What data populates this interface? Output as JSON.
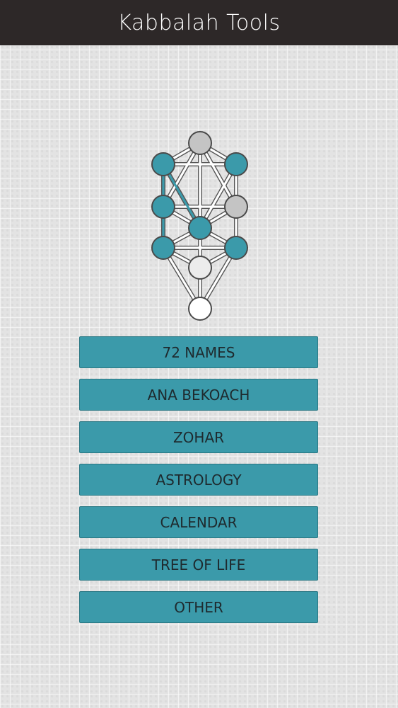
{
  "header": {
    "title": "Kabbalah Tools"
  },
  "colors": {
    "header_bg": "#2d2828",
    "accent": "#3b9aaa",
    "node_gray": "#c4c4c4",
    "node_white": "#ffffff"
  },
  "logo": {
    "icon": "tree-of-life-icon"
  },
  "menu": {
    "items": [
      {
        "label": "72 NAMES"
      },
      {
        "label": "ANA BEKOACH"
      },
      {
        "label": "ZOHAR"
      },
      {
        "label": "ASTROLOGY"
      },
      {
        "label": "CALENDAR"
      },
      {
        "label": "TREE OF LIFE"
      },
      {
        "label": "OTHER"
      }
    ]
  }
}
